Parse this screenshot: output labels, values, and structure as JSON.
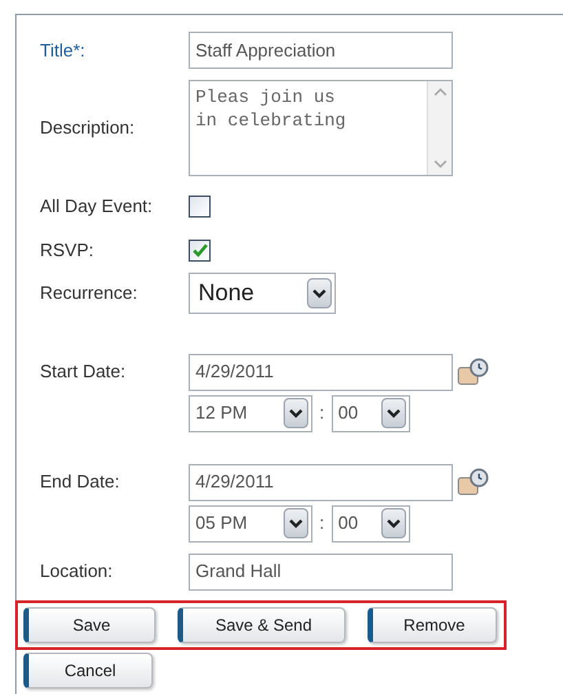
{
  "form": {
    "title": {
      "label": "Title*:",
      "value": "Staff Appreciation"
    },
    "description": {
      "label": "Description:",
      "value": "Pleas join us\nin celebrating"
    },
    "all_day_event": {
      "label": "All Day Event:",
      "checked": false
    },
    "rsvp": {
      "label": "RSVP:",
      "checked": true
    },
    "recurrence": {
      "label": "Recurrence:",
      "value": "None"
    },
    "start": {
      "label": "Start Date:",
      "date": "4/29/2011",
      "hour": "12 PM",
      "separator": ":",
      "minute": "00"
    },
    "end": {
      "label": "End Date:",
      "date": "4/29/2011",
      "hour": "05 PM",
      "separator": ":",
      "minute": "00"
    },
    "location": {
      "label": "Location:",
      "value": "Grand Hall"
    }
  },
  "highlighted_buttons": [
    {
      "label": "Save"
    },
    {
      "label": "Save & Send"
    },
    {
      "label": "Remove"
    }
  ],
  "buttons": [
    {
      "label": "Cancel"
    }
  ]
}
